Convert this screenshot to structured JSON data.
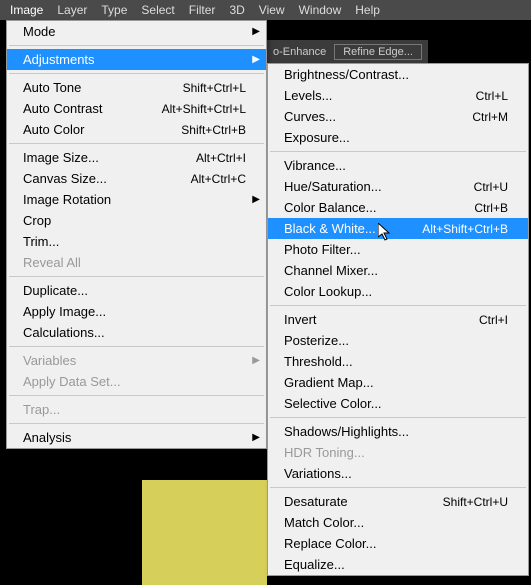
{
  "menubar": {
    "items": [
      "Image",
      "Layer",
      "Type",
      "Select",
      "Filter",
      "3D",
      "View",
      "Window",
      "Help"
    ]
  },
  "toolbar": {
    "auto_enhance": "o-Enhance",
    "refine_edge": "Refine Edge..."
  },
  "menu1": {
    "mode": "Mode",
    "adjustments": "Adjustments",
    "auto_tone": "Auto Tone",
    "auto_tone_sc": "Shift+Ctrl+L",
    "auto_contrast": "Auto Contrast",
    "auto_contrast_sc": "Alt+Shift+Ctrl+L",
    "auto_color": "Auto Color",
    "auto_color_sc": "Shift+Ctrl+B",
    "image_size": "Image Size...",
    "image_size_sc": "Alt+Ctrl+I",
    "canvas_size": "Canvas Size...",
    "canvas_size_sc": "Alt+Ctrl+C",
    "image_rotation": "Image Rotation",
    "crop": "Crop",
    "trim": "Trim...",
    "reveal_all": "Reveal All",
    "duplicate": "Duplicate...",
    "apply_image": "Apply Image...",
    "calculations": "Calculations...",
    "variables": "Variables",
    "apply_data_set": "Apply Data Set...",
    "trap": "Trap...",
    "analysis": "Analysis"
  },
  "menu2": {
    "brightness_contrast": "Brightness/Contrast...",
    "levels": "Levels...",
    "levels_sc": "Ctrl+L",
    "curves": "Curves...",
    "curves_sc": "Ctrl+M",
    "exposure": "Exposure...",
    "vibrance": "Vibrance...",
    "hue_sat": "Hue/Saturation...",
    "hue_sat_sc": "Ctrl+U",
    "color_balance": "Color Balance...",
    "color_balance_sc": "Ctrl+B",
    "black_white": "Black & White...",
    "black_white_sc": "Alt+Shift+Ctrl+B",
    "photo_filter": "Photo Filter...",
    "channel_mixer": "Channel Mixer...",
    "color_lookup": "Color Lookup...",
    "invert": "Invert",
    "invert_sc": "Ctrl+I",
    "posterize": "Posterize...",
    "threshold": "Threshold...",
    "gradient_map": "Gradient Map...",
    "selective_color": "Selective Color...",
    "shadows_highlights": "Shadows/Highlights...",
    "hdr_toning": "HDR Toning...",
    "variations": "Variations...",
    "desaturate": "Desaturate",
    "desaturate_sc": "Shift+Ctrl+U",
    "match_color": "Match Color...",
    "replace_color": "Replace Color...",
    "equalize": "Equalize..."
  }
}
